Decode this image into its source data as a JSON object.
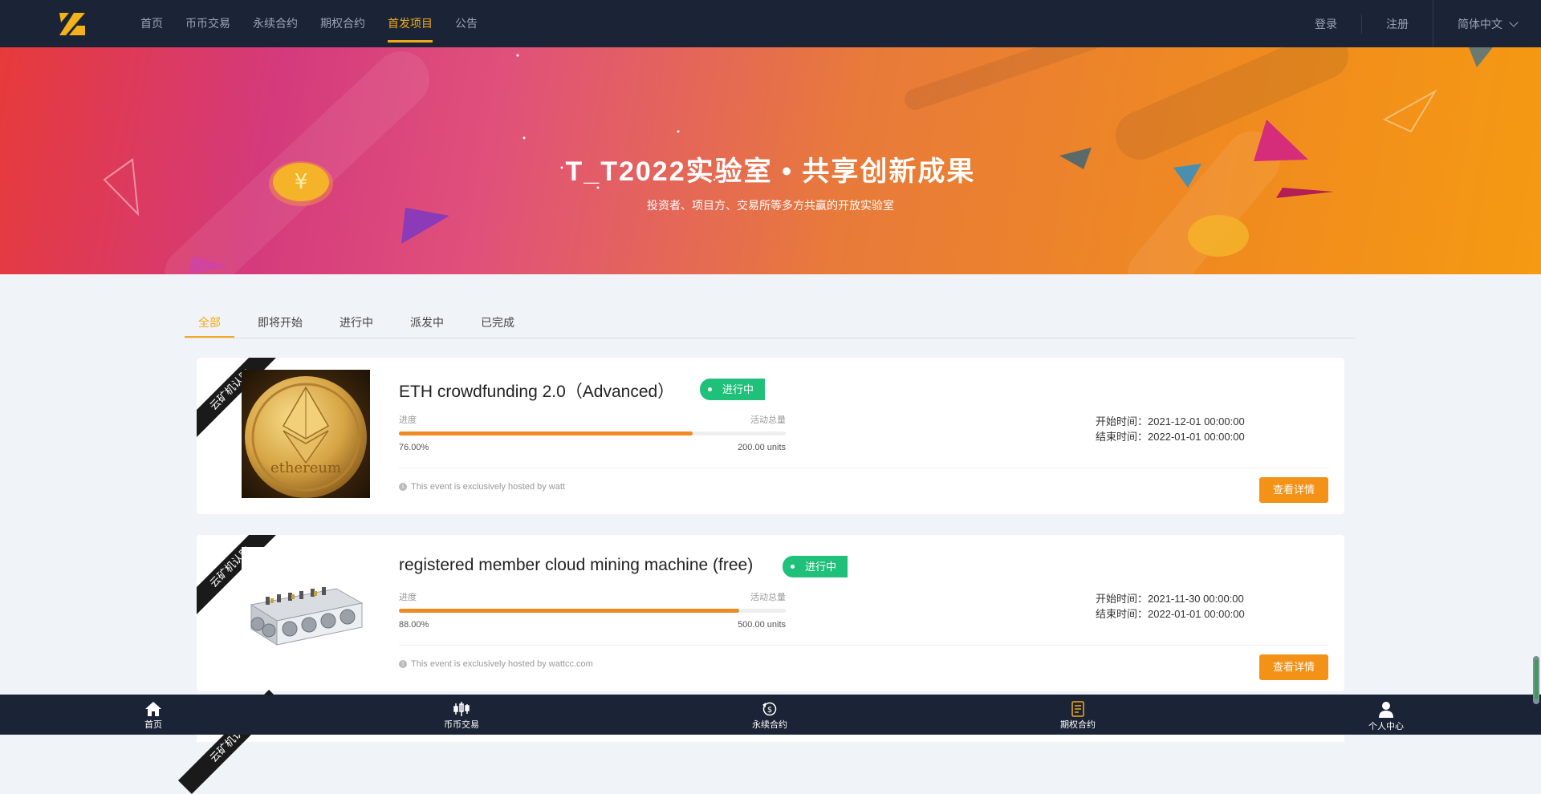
{
  "nav": {
    "links": [
      "首页",
      "币币交易",
      "永续合约",
      "期权合约",
      "首发项目",
      "公告"
    ],
    "active_index": 4,
    "login": "登录",
    "register": "注册",
    "language": "简体中文"
  },
  "banner": {
    "title": "T_T2022实验室 • 共享创新成果",
    "subtitle": "投资者、项目方、交易所等多方共赢的开放实验室"
  },
  "tabs": [
    "全部",
    "即将开始",
    "进行中",
    "派发中",
    "已完成"
  ],
  "active_tab": 0,
  "projects": [
    {
      "ribbon": "云矿机认购",
      "title": "ETH crowdfunding 2.0（Advanced）",
      "status": "进行中",
      "progress_label": "进度",
      "total_label": "活动总量",
      "progress_text": "76.00%",
      "progress": 0.76,
      "total": "200.00 units",
      "start_time": "开始时间：2021-12-01 00:00:00",
      "end_time": "结束时间：2022-01-01 00:00:00",
      "host": "This event is exclusively hosted by watt",
      "button": "查看详情",
      "image": "ethereum-coin",
      "coin_text": "ethereum"
    },
    {
      "ribbon": "云矿机认购",
      "title": "registered member cloud mining machine (free)",
      "status": "进行中",
      "progress_label": "进度",
      "total_label": "活动总量",
      "progress_text": "88.00%",
      "progress": 0.88,
      "total": "500.00 units",
      "start_time": "开始时间：2021-11-30 00:00:00",
      "end_time": "结束时间：2022-01-01 00:00:00",
      "host": "This event is exclusively hosted by wattcc.com",
      "button": "查看详情",
      "image": "mining-rig"
    }
  ],
  "third_ribbon": "云矿机认购",
  "bottom_nav": [
    "首页",
    "币币交易",
    "永续合约",
    "期权合约",
    "个人中心"
  ],
  "colors": {
    "nav_bg": "#1a2436",
    "accent": "#f3a81a",
    "status_green": "#1fc07a",
    "button_orange": "#f39216",
    "progress_orange": "#f08a1f"
  }
}
